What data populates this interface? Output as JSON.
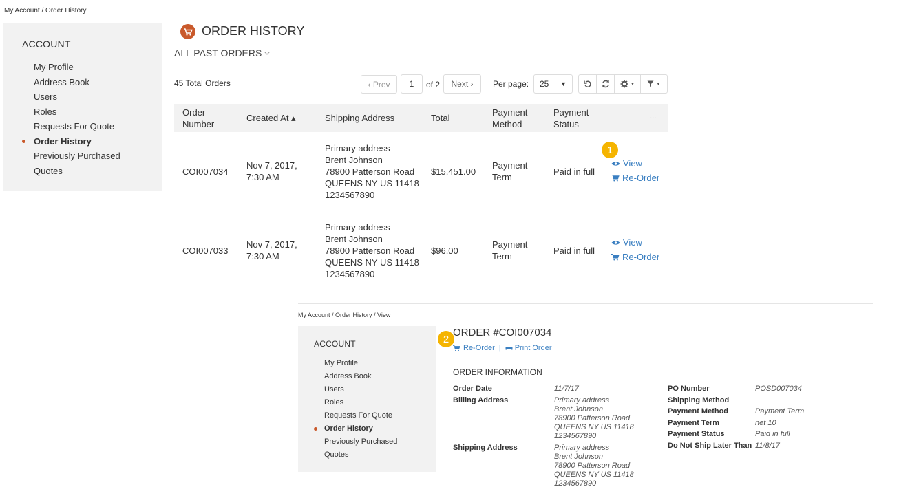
{
  "top": {
    "breadcrumb": "My Account / Order History",
    "sidebar": {
      "title": "ACCOUNT",
      "items": [
        "My Profile",
        "Address Book",
        "Users",
        "Roles",
        "Requests For Quote",
        "Order History",
        "Previously Purchased",
        "Quotes"
      ],
      "active_index": 5
    },
    "page_title": "ORDER HISTORY",
    "filter_label": "ALL PAST ORDERS",
    "total_orders": "45 Total Orders",
    "pager": {
      "prev": "‹ Prev",
      "page": "1",
      "of": "of 2",
      "next": "Next ›",
      "per_page_label": "Per page:",
      "per_page_value": "25"
    },
    "table": {
      "headers": [
        "Order Number",
        "Created At ▴",
        "Shipping Address",
        "Total",
        "Payment Method",
        "Payment Status",
        "···"
      ],
      "rows": [
        {
          "order_number": "COI007034",
          "created": "Nov 7, 2017, 7:30 AM",
          "address": [
            "Primary address",
            "Brent Johnson",
            "78900 Patterson Road",
            "QUEENS NY US 11418",
            "1234567890"
          ],
          "total": "$15,451.00",
          "method": "Payment Term",
          "status": "Paid in full",
          "view": "View",
          "reorder": "Re-Order"
        },
        {
          "order_number": "COI007033",
          "created": "Nov 7, 2017, 7:30 AM",
          "address": [
            "Primary address",
            "Brent Johnson",
            "78900 Patterson Road",
            "QUEENS NY US 11418",
            "1234567890"
          ],
          "total": "$96.00",
          "method": "Payment Term",
          "status": "Paid in full",
          "view": "View",
          "reorder": "Re-Order"
        }
      ]
    },
    "callout": "1"
  },
  "detail": {
    "breadcrumb": "My Account / Order History / View",
    "sidebar": {
      "title": "ACCOUNT",
      "items": [
        "My Profile",
        "Address Book",
        "Users",
        "Roles",
        "Requests For Quote",
        "Order History",
        "Previously Purchased",
        "Quotes"
      ],
      "active_index": 5
    },
    "title": "ORDER #COI007034",
    "callout": "2",
    "reorder": "Re-Order",
    "separator": "|",
    "print": "Print Order",
    "section_title": "ORDER INFORMATION",
    "left": {
      "order_date_label": "Order Date",
      "order_date": "11/7/17",
      "billing_label": "Billing Address",
      "billing": [
        "Primary address",
        "Brent Johnson",
        "78900 Patterson Road",
        "QUEENS NY US 11418",
        "1234567890"
      ],
      "shipping_label": "Shipping Address",
      "shipping": [
        "Primary address",
        "Brent Johnson",
        "78900 Patterson Road",
        "QUEENS NY US 11418",
        "1234567890"
      ]
    },
    "right": [
      {
        "label": "PO Number",
        "value": "POSD007034"
      },
      {
        "label": "Shipping Method",
        "value": ""
      },
      {
        "label": "Payment Method",
        "value": "Payment Term"
      },
      {
        "label": "Payment Term",
        "value": "net 10"
      },
      {
        "label": "Payment Status",
        "value": "Paid in full"
      },
      {
        "label": "Do Not Ship Later Than",
        "value": "11/8/17"
      }
    ]
  },
  "colors": {
    "accent": "#c9592b",
    "link": "#3a7fc1",
    "callout": "#f5b400",
    "sidebar_bg": "#f2f2f2"
  }
}
